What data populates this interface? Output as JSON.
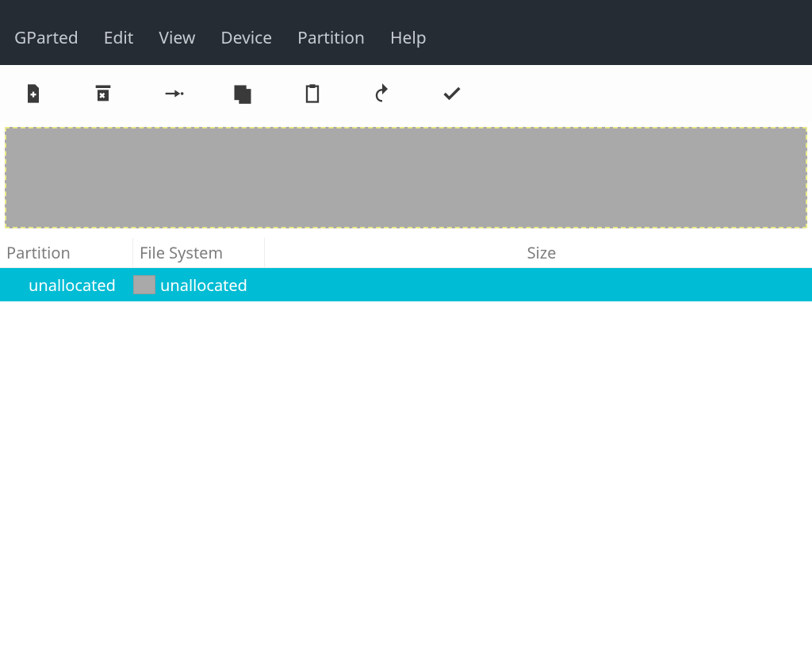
{
  "menubar": {
    "items": [
      "GParted",
      "Edit",
      "View",
      "Device",
      "Partition",
      "Help"
    ]
  },
  "toolbar": {
    "new": "New",
    "delete": "Delete",
    "resize": "Resize/Move",
    "copy": "Copy",
    "paste": "Paste",
    "undo": "Undo",
    "apply": "Apply"
  },
  "columns": {
    "partition": "Partition",
    "filesystem": "File System",
    "size": "Size"
  },
  "rows": [
    {
      "partition": "unallocated",
      "filesystem": "unallocated",
      "size": "",
      "selected": true,
      "fs_color": "#a9a9a9"
    }
  ],
  "colors": {
    "menubar_bg": "#252c33",
    "selection": "#00bcd4"
  }
}
